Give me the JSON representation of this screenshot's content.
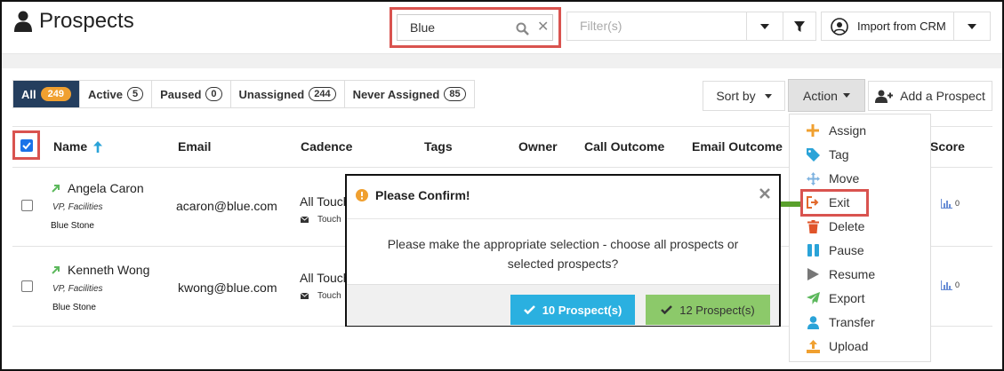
{
  "header": {
    "title": "Prospects"
  },
  "search": {
    "value": "Blue",
    "clear_glyph": "✕"
  },
  "filter": {
    "placeholder": "Filter(s)"
  },
  "import": {
    "label": "Import from CRM"
  },
  "tabs": [
    {
      "label": "All",
      "count": "249"
    },
    {
      "label": "Active",
      "count": "5"
    },
    {
      "label": "Paused",
      "count": "0"
    },
    {
      "label": "Unassigned",
      "count": "244"
    },
    {
      "label": "Never Assigned",
      "count": "85"
    }
  ],
  "toolbar": {
    "sort_label": "Sort by",
    "action_label": "Action",
    "add_label": "Add a Prospect"
  },
  "columns": {
    "name": "Name",
    "email": "Email",
    "cadence": "Cadence",
    "tags": "Tags",
    "owner": "Owner",
    "call": "Call Outcome",
    "email_outcome": "Email Outcome",
    "score": "Score"
  },
  "rows": [
    {
      "name": "Angela Caron",
      "title": "VP, Facilities",
      "company": "Blue Stone",
      "email": "acaron@blue.com",
      "cadence": "All Touch",
      "touch": "Touch",
      "score": "0"
    },
    {
      "name": "Kenneth Wong",
      "title": "VP, Facilities",
      "company": "Blue Stone",
      "email": "kwong@blue.com",
      "cadence": "All Touch",
      "touch": "Touch",
      "score": "0"
    }
  ],
  "action_menu": [
    {
      "label": "Assign",
      "icon": "plus-icon",
      "color": "#f0a030"
    },
    {
      "label": "Tag",
      "icon": "tag-icon",
      "color": "#2aa3d8"
    },
    {
      "label": "Move",
      "icon": "move-arrows-icon",
      "color": "#7fb3e0"
    },
    {
      "label": "Exit",
      "icon": "exit-icon",
      "color": "#e26a2c"
    },
    {
      "label": "Delete",
      "icon": "trash-icon",
      "color": "#e0542a"
    },
    {
      "label": "Pause",
      "icon": "pause-icon",
      "color": "#2aa3d8"
    },
    {
      "label": "Resume",
      "icon": "play-icon",
      "color": "#777777"
    },
    {
      "label": "Export",
      "icon": "paper-plane-icon",
      "color": "#5cb85c"
    },
    {
      "label": "Transfer",
      "icon": "user-icon",
      "color": "#2aa3d8"
    },
    {
      "label": "Upload",
      "icon": "upload-icon",
      "color": "#f0a030"
    }
  ],
  "modal": {
    "title": "Please Confirm!",
    "message_line1": "Please make the appropriate selection - choose all prospects or",
    "message_line2": "selected prospects?",
    "btn_primary": "10 Prospect(s)",
    "btn_secondary": "12 Prospect(s)"
  },
  "colors": {
    "navy": "#243e5e",
    "orange": "#f0a030",
    "red_highlight": "#d9534f",
    "blue_button": "#2ab0e0",
    "green_button": "#8cc96a",
    "arrow_green": "#5aa02c"
  }
}
